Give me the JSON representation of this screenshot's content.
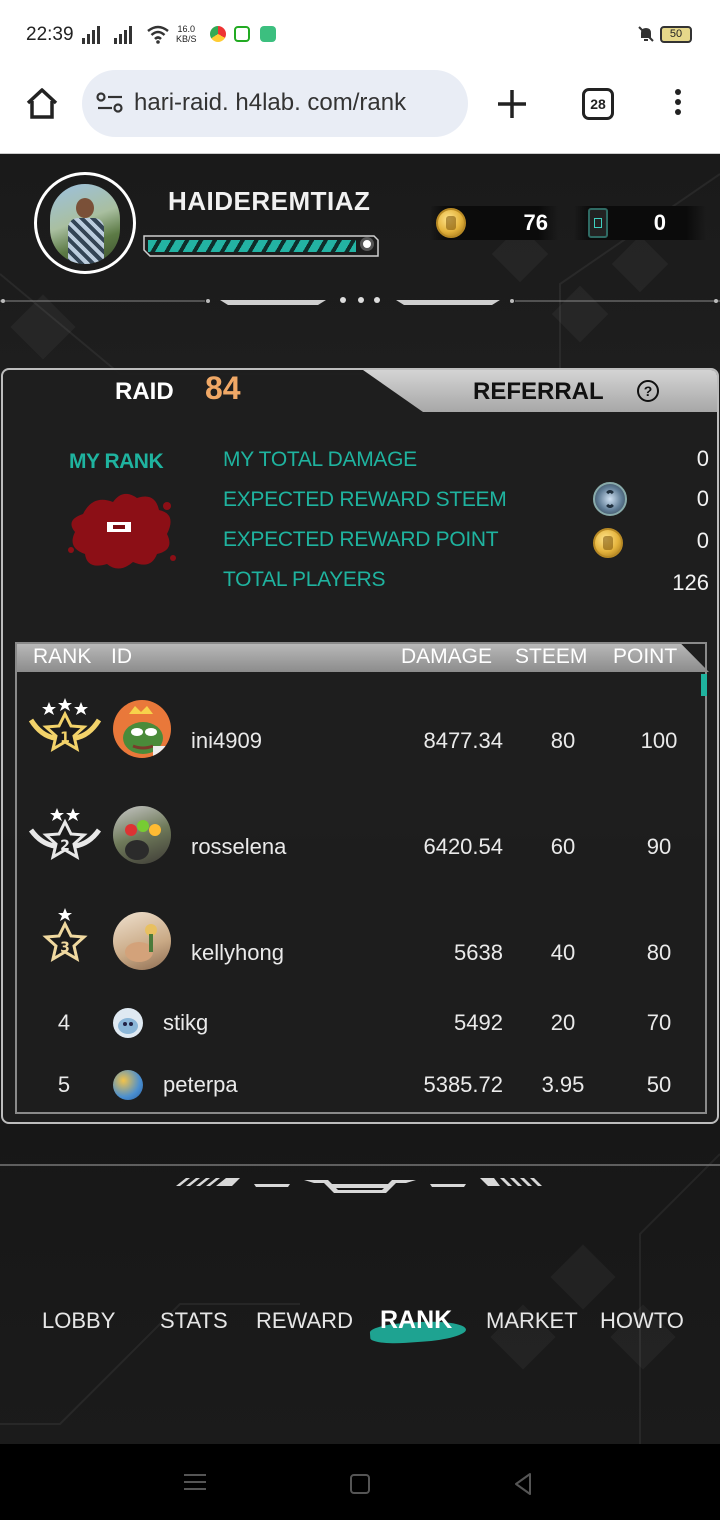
{
  "status_bar": {
    "time": "22:39",
    "net_speed_value": "16.0",
    "net_speed_unit": "KB/S",
    "battery": "50"
  },
  "browser": {
    "url": "hari-raid. h4lab. com/rank",
    "tab_count": "28"
  },
  "profile": {
    "username": "HAIDEREMTIAZ",
    "xp_fraction": 0.92,
    "point_balance": "76",
    "ticket_balance": "0"
  },
  "tabs": {
    "raid_label": "RAID",
    "raid_count": "84",
    "referral_label": "REFERRAL",
    "help_glyph": "?"
  },
  "my_rank": {
    "label": "MY RANK",
    "stats": [
      {
        "label": "MY TOTAL DAMAGE",
        "value": "0"
      },
      {
        "label": "EXPECTED REWARD STEEM",
        "value": "0"
      },
      {
        "label": "EXPECTED REWARD POINT",
        "value": "0"
      },
      {
        "label": "TOTAL PLAYERS",
        "value": "126"
      }
    ]
  },
  "leaderboard": {
    "headers": {
      "rank": "RANK",
      "id": "ID",
      "damage": "DAMAGE",
      "steem": "STEEM",
      "point": "POINT"
    },
    "rows": [
      {
        "rank": "1",
        "id": "ini4909",
        "damage": "8477.34",
        "steem": "80",
        "point": "100"
      },
      {
        "rank": "2",
        "id": "rosselena",
        "damage": "6420.54",
        "steem": "60",
        "point": "90"
      },
      {
        "rank": "3",
        "id": "kellyhong",
        "damage": "5638",
        "steem": "40",
        "point": "80"
      },
      {
        "rank": "4",
        "id": "stikg",
        "damage": "5492",
        "steem": "20",
        "point": "70"
      },
      {
        "rank": "5",
        "id": "peterpa",
        "damage": "5385.72",
        "steem": "3.95",
        "point": "50"
      }
    ]
  },
  "nav": {
    "items": [
      "LOBBY",
      "STATS",
      "REWARD",
      "RANK",
      "MARKET",
      "HOWTO"
    ],
    "active": "RANK"
  },
  "colors": {
    "accent_teal": "#1fb39f",
    "raid_count_orange": "#f0a866",
    "rank_splat_red": "#8c0f16"
  },
  "icons": [
    "home-icon",
    "site-info-icon",
    "plus-icon",
    "tabs-icon",
    "more-vert-icon",
    "coin-icon",
    "ticket-icon",
    "steem-icon",
    "help-icon",
    "medal-icon"
  ]
}
